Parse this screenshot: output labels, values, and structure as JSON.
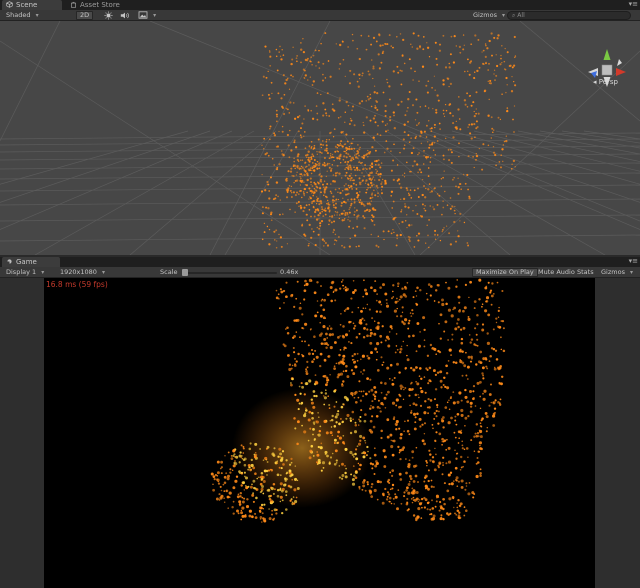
{
  "scene_tabs": [
    {
      "label": "Scene",
      "icon": "scene-icon",
      "active": true
    },
    {
      "label": "Asset Store",
      "icon": "asset-store-icon",
      "active": false
    }
  ],
  "scene_toolbar": {
    "shading_mode": "Shaded",
    "mode_2d": "2D",
    "gizmos_label": "Gizmos",
    "search_placeholder": "All"
  },
  "scene_gizmo": {
    "projection_label": "Persp"
  },
  "game_tabs": [
    {
      "label": "Game",
      "icon": "game-icon",
      "active": true
    }
  ],
  "game_toolbar": {
    "display": "Display 1",
    "resolution": "1920x1080",
    "scale_label": "Scale",
    "scale_value": "0.46x",
    "scale_fraction": 0.0,
    "maximize_on_play": "Maximize On Play",
    "mute_audio": "Mute Audio",
    "stats": "Stats",
    "gizmos_label": "Gizmos"
  },
  "game_view": {
    "fps_readout": "16.8 ms (59 fps)"
  },
  "colors": {
    "particle_orange": "#ff8a18",
    "particle_yellow": "#ffd040",
    "scene_background": "#474747",
    "game_background": "#000000",
    "fps_text": "#c43a2c",
    "gizmo_y_green": "#7ac943",
    "gizmo_x_red": "#d23a2a",
    "gizmo_z_blue": "#3f6ee0"
  }
}
